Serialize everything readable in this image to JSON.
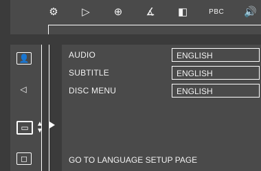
{
  "top_menu": {
    "icons": [
      "settings-icon",
      "play-icon",
      "zoom-icon",
      "angle-icon",
      "step-icon",
      "pbc-icon",
      "audio-icon"
    ],
    "pbc_label": "PBC"
  },
  "sidebar": {
    "items": [
      {
        "name": "language-icon"
      },
      {
        "name": "speaker-icon"
      },
      {
        "name": "subtitle-icon"
      },
      {
        "name": "folder-icon"
      }
    ]
  },
  "settings": {
    "rows": [
      {
        "label": "AUDIO",
        "value": "ENGLISH"
      },
      {
        "label": "SUBTITLE",
        "value": "ENGLISH"
      },
      {
        "label": "DISC MENU",
        "value": "ENGLISH"
      }
    ]
  },
  "footer": {
    "text": "GO TO LANGUAGE SETUP PAGE"
  }
}
